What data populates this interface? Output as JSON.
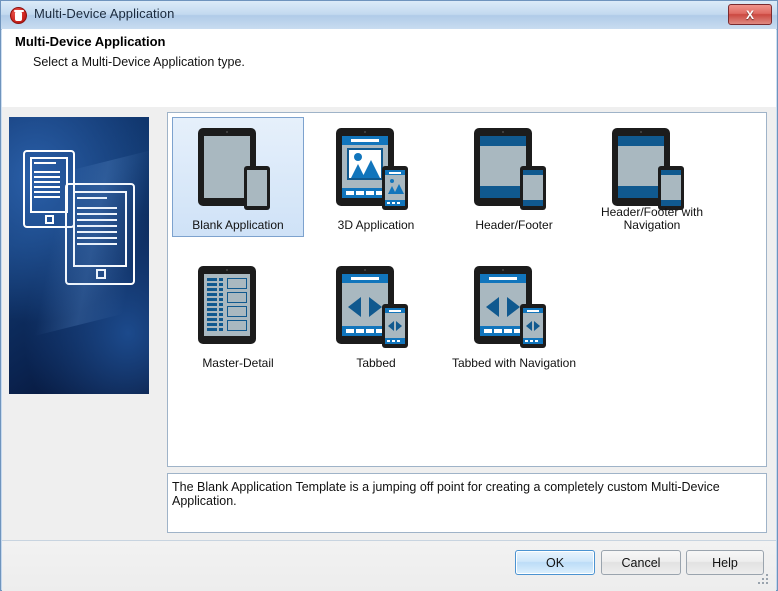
{
  "window": {
    "title": "Multi-Device Application",
    "icon": "trash-can-icon",
    "close_label": "X"
  },
  "header": {
    "title": "Multi-Device Application",
    "subtitle": "Select a Multi-Device Application type."
  },
  "templates": [
    {
      "id": "blank-application",
      "label": "Blank Application",
      "selected": true
    },
    {
      "id": "3d-application",
      "label": "3D Application",
      "selected": false
    },
    {
      "id": "header-footer",
      "label": "Header/Footer",
      "selected": false
    },
    {
      "id": "header-footer-navigation",
      "label": "Header/Footer with Navigation",
      "selected": false
    },
    {
      "id": "master-detail",
      "label": "Master-Detail",
      "selected": false
    },
    {
      "id": "tabbed",
      "label": "Tabbed",
      "selected": false
    },
    {
      "id": "tabbed-navigation",
      "label": "Tabbed with Navigation",
      "selected": false
    }
  ],
  "description": "The Blank Application Template is a jumping off point for creating a completely custom Multi-Device Application.",
  "footer": {
    "ok_label": "OK",
    "cancel_label": "Cancel",
    "help_label": "Help"
  },
  "colors": {
    "accent_blue": "#1175bc",
    "accent_blue_dark": "#10598f",
    "device_body": "#1c1c1c",
    "device_screen": "#a9b8c0",
    "selection_border": "#7da2ce",
    "banner_dark": "#0d2f66",
    "close_red": "#cb4840"
  }
}
